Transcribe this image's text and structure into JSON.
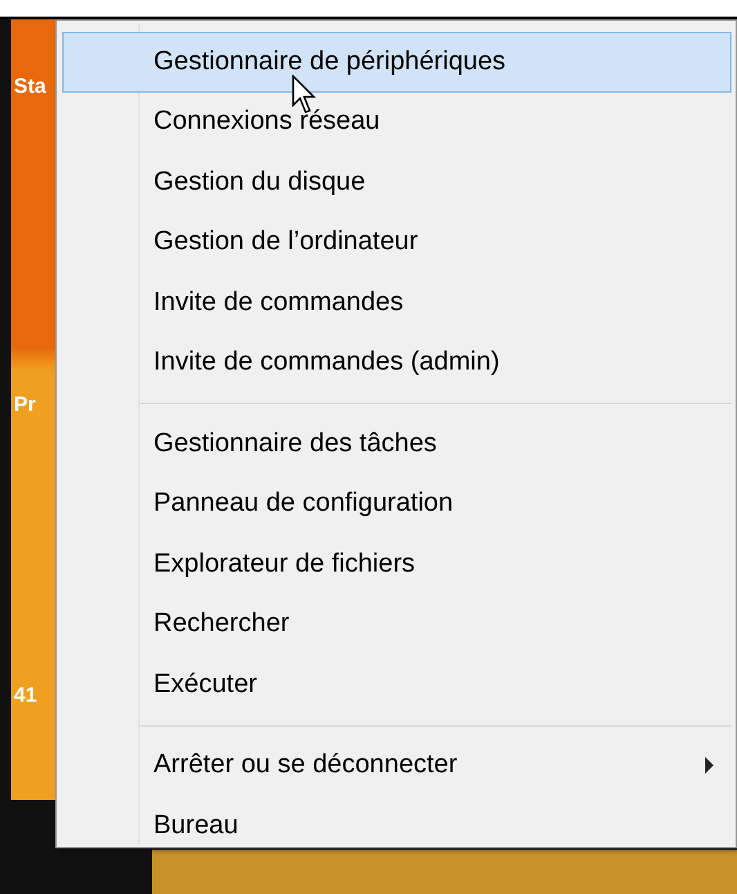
{
  "background_tiles": [
    {
      "label": "Sta"
    },
    {
      "label": "Pr"
    },
    {
      "label": "41"
    }
  ],
  "menu": {
    "sections": [
      [
        {
          "label": "Gestionnaire de périphériques",
          "selected": true,
          "submenu": false
        },
        {
          "label": "Connexions réseau",
          "selected": false,
          "submenu": false
        },
        {
          "label": "Gestion du disque",
          "selected": false,
          "submenu": false
        },
        {
          "label": "Gestion de l’ordinateur",
          "selected": false,
          "submenu": false
        },
        {
          "label": "Invite de commandes",
          "selected": false,
          "submenu": false
        },
        {
          "label": "Invite de commandes (admin)",
          "selected": false,
          "submenu": false
        }
      ],
      [
        {
          "label": "Gestionnaire des tâches",
          "selected": false,
          "submenu": false
        },
        {
          "label": "Panneau de configuration",
          "selected": false,
          "submenu": false
        },
        {
          "label": "Explorateur de fichiers",
          "selected": false,
          "submenu": false
        },
        {
          "label": "Rechercher",
          "selected": false,
          "submenu": false
        },
        {
          "label": "Exécuter",
          "selected": false,
          "submenu": false
        }
      ],
      [
        {
          "label": "Arrêter ou se déconnecter",
          "selected": false,
          "submenu": true
        },
        {
          "label": "Bureau",
          "selected": false,
          "submenu": false
        }
      ]
    ]
  }
}
